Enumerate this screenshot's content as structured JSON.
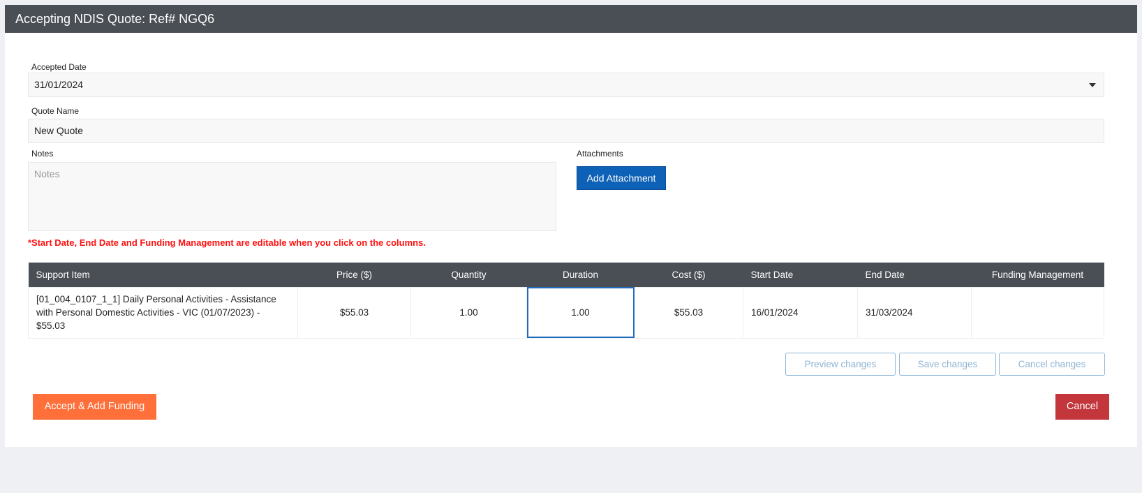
{
  "header": {
    "title": "Accepting NDIS Quote: Ref# NGQ6"
  },
  "form": {
    "accepted_date_label": "Accepted Date",
    "accepted_date_value": "31/01/2024",
    "quote_name_label": "Quote Name",
    "quote_name_value": "New Quote",
    "notes_label": "Notes",
    "notes_placeholder": "Notes",
    "attachments_label": "Attachments",
    "add_attachment_label": "Add Attachment",
    "warning": "*Start Date, End Date and Funding Management are editable when you click on the columns."
  },
  "table": {
    "headers": [
      "Support Item",
      "Price ($)",
      "Quantity",
      "Duration",
      "Cost ($)",
      "Start Date",
      "End Date",
      "Funding Management"
    ],
    "rows": [
      {
        "support_item": "[01_004_0107_1_1] Daily Personal Activities - Assistance with Personal Domestic Activities - VIC (01/07/2023) - $55.03",
        "price": "$55.03",
        "quantity": "1.00",
        "duration": "1.00",
        "cost": "$55.03",
        "start_date": "16/01/2024",
        "end_date": "31/03/2024",
        "funding_management": ""
      }
    ]
  },
  "actions": {
    "preview_changes": "Preview changes",
    "save_changes": "Save changes",
    "cancel_changes": "Cancel changes",
    "accept_add_funding": "Accept & Add Funding",
    "cancel": "Cancel"
  },
  "icons": {
    "date_dropdown": "caret-down-icon"
  },
  "colors": {
    "header_bg": "#4a4e55",
    "primary": "#0d61b6",
    "accept": "#fe6f39",
    "cancel": "#c2363c",
    "warning": "#ff1010"
  }
}
